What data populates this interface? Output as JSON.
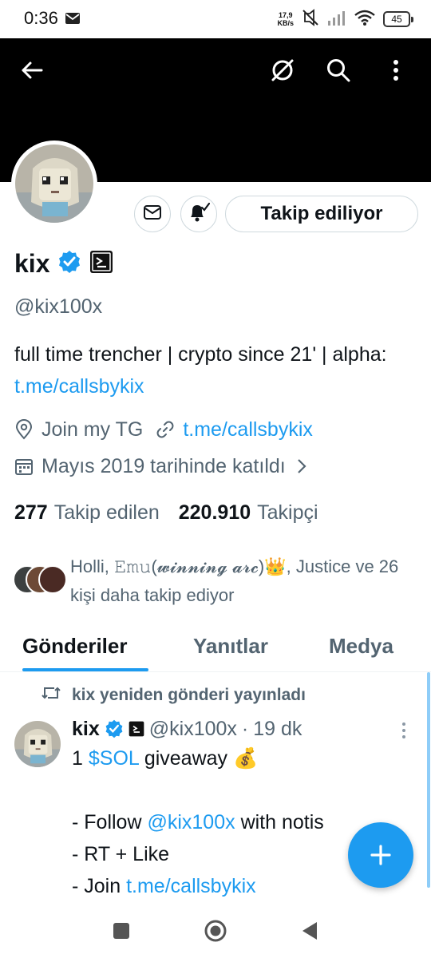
{
  "status_bar": {
    "time": "0:36",
    "speed_value": "17,9",
    "speed_unit": "KB/s",
    "battery": "45",
    "icons": [
      "mail-icon",
      "muted-icon",
      "signal-icon",
      "wifi-icon",
      "battery-icon"
    ]
  },
  "header": {
    "icons": [
      "back-arrow-icon",
      "grok-icon",
      "search-icon",
      "more-vertical-icon"
    ]
  },
  "actions": {
    "message_icon": "mail-icon",
    "notify_icon": "bell-check-icon",
    "follow_label": "Takip ediliyor"
  },
  "profile": {
    "name": "kix",
    "handle": "@kix100x",
    "bio_text": "full time trencher | crypto since 21' | alpha: ",
    "bio_link": "t.me/callsbykix",
    "location": "Join my TG",
    "website": "t.me/callsbykix",
    "joined": "Mayıs 2019 tarihinde katıldı",
    "following_count": "277",
    "following_label": "Takip edilen",
    "followers_count": "220.910",
    "followers_label": "Takipçi",
    "followed_by": "Holli, 𝙴𝚖𝚞(𝔀𝓲𝓷𝓷𝓲𝓷𝓰 𝓪𝓻𝓬)👑, Justice ve 26 kişi daha takip ediyor"
  },
  "tabs": [
    {
      "label": "Gönderiler",
      "active": true
    },
    {
      "label": "Yanıtlar",
      "active": false
    },
    {
      "label": "Medya",
      "active": false
    }
  ],
  "post": {
    "repost_label": "kix yeniden gönderi yayınladı",
    "author_name": "kix",
    "author_handle": "@kix100x",
    "separator": "·",
    "time": "19 dk",
    "line1_pre": "1 ",
    "line1_tag": "$SOL",
    "line1_post": " giveaway 💰",
    "line2_pre": "- Follow ",
    "line2_mention": "@kix100x",
    "line2_post": " with notis",
    "line3": "- RT + Like",
    "line4_pre": "- Join ",
    "line4_link": "t.me/callsbykix"
  },
  "fab": {
    "icon": "plus-icon"
  },
  "nav_bar": {
    "icons": [
      "recents-square-icon",
      "home-circle-icon",
      "back-triangle-icon"
    ]
  },
  "colors": {
    "accent": "#1d9bf0",
    "banner": "#000000",
    "text_secondary": "#536471"
  }
}
